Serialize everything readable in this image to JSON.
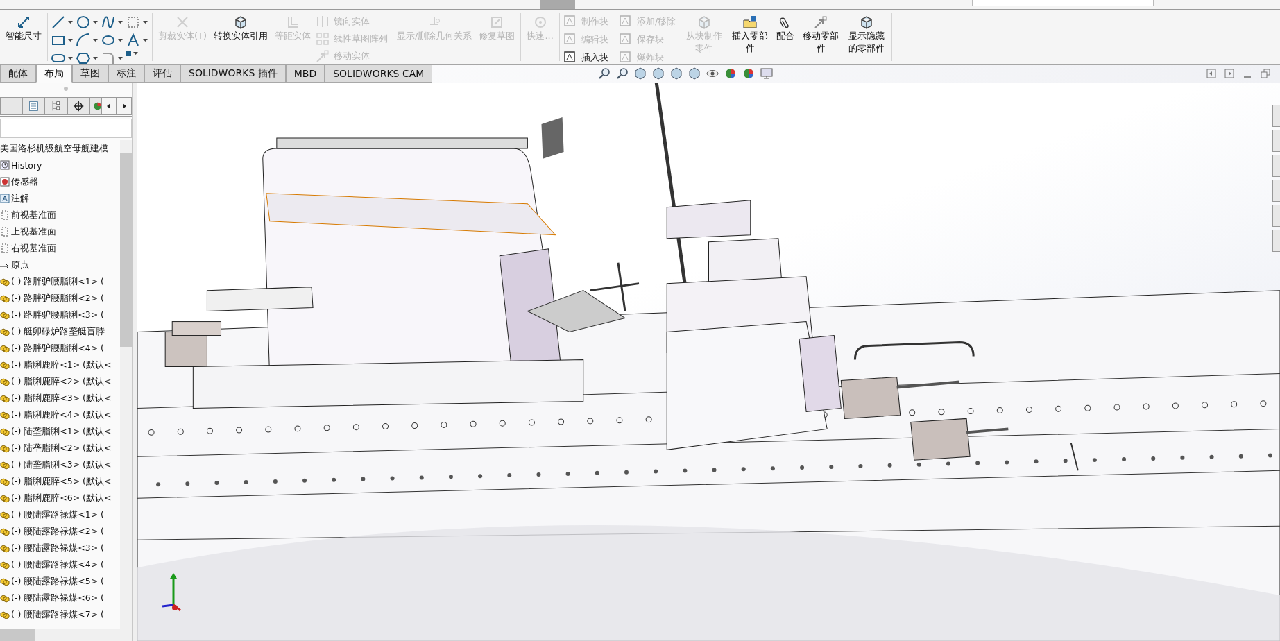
{
  "ribbon": {
    "smart_dimension": {
      "label": "智能尺寸",
      "disabled": false
    },
    "sketch_commands": [
      {
        "label": "剪裁实体(T)",
        "disabled": true
      },
      {
        "label": "转换实体引用",
        "disabled": false
      },
      {
        "label": "等距实体",
        "disabled": true
      }
    ],
    "sketch_list": [
      {
        "label": "镜向实体",
        "disabled": true
      },
      {
        "label": "线性草图阵列",
        "disabled": true
      },
      {
        "label": "移动实体",
        "disabled": true
      }
    ],
    "relations": [
      {
        "label": "显示/删除几何关系",
        "disabled": true
      },
      {
        "label": "修复草图",
        "disabled": true
      }
    ],
    "quick_snaps": {
      "label": "快速...",
      "disabled": true
    },
    "blocks": [
      {
        "label": "制作块",
        "disabled": true
      },
      {
        "label": "添加/移除",
        "disabled": true
      },
      {
        "label": "编辑块",
        "disabled": true
      },
      {
        "label": "保存块",
        "disabled": true
      },
      {
        "label": "插入块",
        "disabled": false
      },
      {
        "label": "爆炸块",
        "disabled": true
      }
    ],
    "assembly": [
      {
        "label": "从块制作零件",
        "disabled": true
      },
      {
        "label": "插入零部件",
        "disabled": false
      },
      {
        "label": "配合",
        "disabled": false
      },
      {
        "label": "移动零部件",
        "disabled": false
      },
      {
        "label": "显示隐藏的零部件",
        "disabled": false
      }
    ]
  },
  "tabs": [
    {
      "label": "配体",
      "selected": false
    },
    {
      "label": "布局",
      "selected": true
    },
    {
      "label": "草图",
      "selected": false
    },
    {
      "label": "标注",
      "selected": false
    },
    {
      "label": "评估",
      "selected": false
    },
    {
      "label": "SOLIDWORKS 插件",
      "selected": false
    },
    {
      "label": "MBD",
      "selected": false
    },
    {
      "label": "SOLIDWORKS CAM",
      "selected": false
    }
  ],
  "feature_tree": {
    "title": "美国洛杉机级航空母舰建模",
    "items": [
      {
        "kind": "history",
        "label": "History"
      },
      {
        "kind": "sensor",
        "label": "传感器"
      },
      {
        "kind": "annotation",
        "label": "注解"
      },
      {
        "kind": "plane",
        "label": "前视基准面"
      },
      {
        "kind": "plane",
        "label": "上视基准面"
      },
      {
        "kind": "plane",
        "label": "右视基准面"
      },
      {
        "kind": "origin",
        "label": "原点"
      },
      {
        "kind": "part",
        "label": "(-) 路胖驴腰脂脷<1> ("
      },
      {
        "kind": "part",
        "label": "(-) 路胖驴腰脂脷<2> ("
      },
      {
        "kind": "part",
        "label": "(-) 路胖驴腰脂脷<3> ("
      },
      {
        "kind": "part",
        "label": "(-) 艇卯碌炉路垄艇盲脖"
      },
      {
        "kind": "part",
        "label": "(-) 路胖驴腰脂脷<4> ("
      },
      {
        "kind": "part",
        "label": "(-) 脂脷鹿脺<1> (默认<"
      },
      {
        "kind": "part",
        "label": "(-) 脂脷鹿脺<2> (默认<"
      },
      {
        "kind": "part",
        "label": "(-) 脂脷鹿脺<3> (默认<"
      },
      {
        "kind": "part",
        "label": "(-) 脂脷鹿脺<4> (默认<"
      },
      {
        "kind": "part",
        "label": "(-) 陆垄脂脷<1> (默认<"
      },
      {
        "kind": "part",
        "label": "(-) 陆垄脂脷<2> (默认<"
      },
      {
        "kind": "part",
        "label": "(-) 陆垄脂脷<3> (默认<"
      },
      {
        "kind": "part",
        "label": "(-) 脂脷鹿脺<5> (默认<"
      },
      {
        "kind": "part",
        "label": "(-) 脂脷鹿脺<6> (默认<"
      },
      {
        "kind": "part",
        "label": "(-) 腰陆露路禄煤<1> ("
      },
      {
        "kind": "part",
        "label": "(-) 腰陆露路禄煤<2> ("
      },
      {
        "kind": "part",
        "label": "(-) 腰陆露路禄煤<3> ("
      },
      {
        "kind": "part",
        "label": "(-) 腰陆露路禄煤<4> ("
      },
      {
        "kind": "part",
        "label": "(-) 腰陆露路禄煤<5> ("
      },
      {
        "kind": "part",
        "label": "(-) 腰陆露路禄煤<6> ("
      },
      {
        "kind": "part",
        "label": "(-) 腰陆露路禄煤<7> ("
      }
    ]
  }
}
